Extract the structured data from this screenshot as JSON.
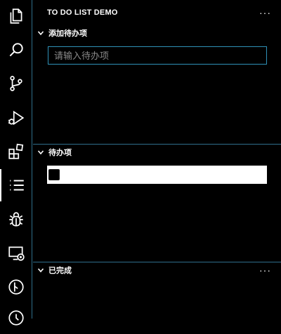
{
  "activity_bar": {
    "items": [
      {
        "icon": "files-icon"
      },
      {
        "icon": "search-icon"
      },
      {
        "icon": "source-control-icon"
      },
      {
        "icon": "run-debug-icon"
      },
      {
        "icon": "extensions-icon"
      },
      {
        "icon": "todo-list-icon",
        "active": true
      },
      {
        "icon": "bug-icon"
      },
      {
        "icon": "remote-explorer-icon"
      },
      {
        "icon": "git-graph-icon"
      },
      {
        "icon": "timeline-icon"
      }
    ]
  },
  "sidebar": {
    "title": "TO DO LIST DEMO",
    "more": "···",
    "sections": {
      "add": {
        "label": "添加待办项"
      },
      "pending": {
        "label": "待办项"
      },
      "done": {
        "label": "已完成",
        "more": "···"
      }
    },
    "input": {
      "placeholder": "请输入待办项",
      "value": ""
    }
  },
  "colors": {
    "background": "#000000",
    "border": "#2f6f8c",
    "input_border": "#2f91b8",
    "text": "#ffffff",
    "placeholder": "#8a8a8a"
  }
}
